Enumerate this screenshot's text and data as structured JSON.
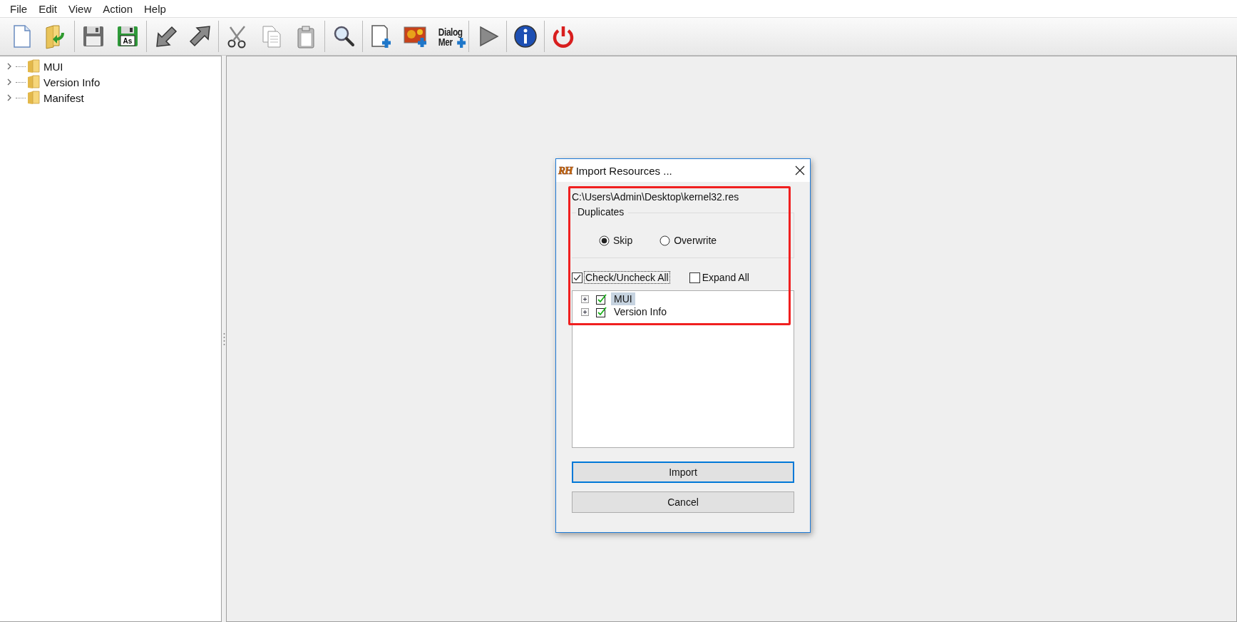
{
  "menu": [
    "File",
    "Edit",
    "View",
    "Action",
    "Help"
  ],
  "toolbar_groups": [
    [
      {
        "kind": "new"
      },
      {
        "kind": "open"
      }
    ],
    [
      {
        "kind": "save"
      },
      {
        "kind": "save-as",
        "text": "As"
      }
    ],
    [
      {
        "kind": "undo"
      },
      {
        "kind": "redo"
      }
    ],
    [
      {
        "kind": "cut"
      },
      {
        "kind": "copy"
      },
      {
        "kind": "paste"
      }
    ],
    [
      {
        "kind": "find"
      }
    ],
    [
      {
        "kind": "add-resource"
      },
      {
        "kind": "add-image"
      },
      {
        "kind": "dialog-merge",
        "text_lines": [
          "Dialog",
          "Mer"
        ]
      }
    ],
    [
      {
        "kind": "run"
      }
    ],
    [
      {
        "kind": "info"
      }
    ],
    [
      {
        "kind": "exit"
      }
    ]
  ],
  "tree": [
    {
      "label": "MUI",
      "expanded": false
    },
    {
      "label": "Version Info",
      "expanded": false
    },
    {
      "label": "Manifest",
      "expanded": false
    }
  ],
  "dialog": {
    "title": "Import Resources ...",
    "logo": "RH",
    "path": "C:\\Users\\Admin\\Desktop\\kernel32.res",
    "group_label": "Duplicates",
    "radios": [
      {
        "label": "Skip",
        "selected": true
      },
      {
        "label": "Overwrite",
        "selected": false
      }
    ],
    "checkboxes": [
      {
        "label": "Check/Uncheck All",
        "checked": true,
        "focused": true
      },
      {
        "label": "Expand All",
        "checked": false,
        "focused": false
      }
    ],
    "items": [
      {
        "label": "MUI",
        "checked": true,
        "selected": true,
        "expanded": false
      },
      {
        "label": "Version Info",
        "checked": true,
        "selected": false,
        "expanded": false
      }
    ],
    "buttons": [
      {
        "label": "Import",
        "default": true
      },
      {
        "label": "Cancel",
        "default": false
      }
    ]
  }
}
